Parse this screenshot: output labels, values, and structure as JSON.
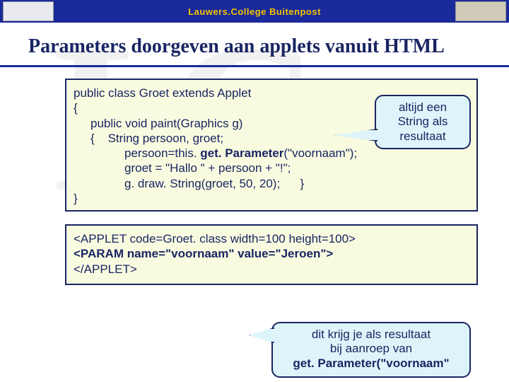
{
  "header": {
    "title": "Lauwers.College   Buitenpost"
  },
  "heading": "Parameters doorgeven aan applets vanuit HTML",
  "code1": {
    "l1": "public class Groet extends Applet",
    "l2": "{",
    "l3": "public void paint(Graphics g)",
    "l4a": "{",
    "l4b": "String persoon, groet;",
    "l5a": "persoon=this. ",
    "l5b": "get. Parameter",
    "l5c": "(\"voornaam\");",
    "l6": "groet = \"Hallo \" + persoon + \"!\";",
    "l7a": "g. draw. String(groet, 50, 20);",
    "l7b": "}",
    "l8": "}"
  },
  "code2": {
    "l1a": "<APPLET code=Groet. class width=100 height=100>",
    "l2a": "<PARAM name=\"voornaam\" value=\"Jeroen\">",
    "l3a": "</APPLET>"
  },
  "callout1": {
    "l1": "altijd een",
    "l2": "String als",
    "l3": "resultaat"
  },
  "callout2": {
    "l1": "dit krijg je als resultaat",
    "l2": "bij aanroep van",
    "l3": "get. Parameter(\"voornaam\""
  }
}
